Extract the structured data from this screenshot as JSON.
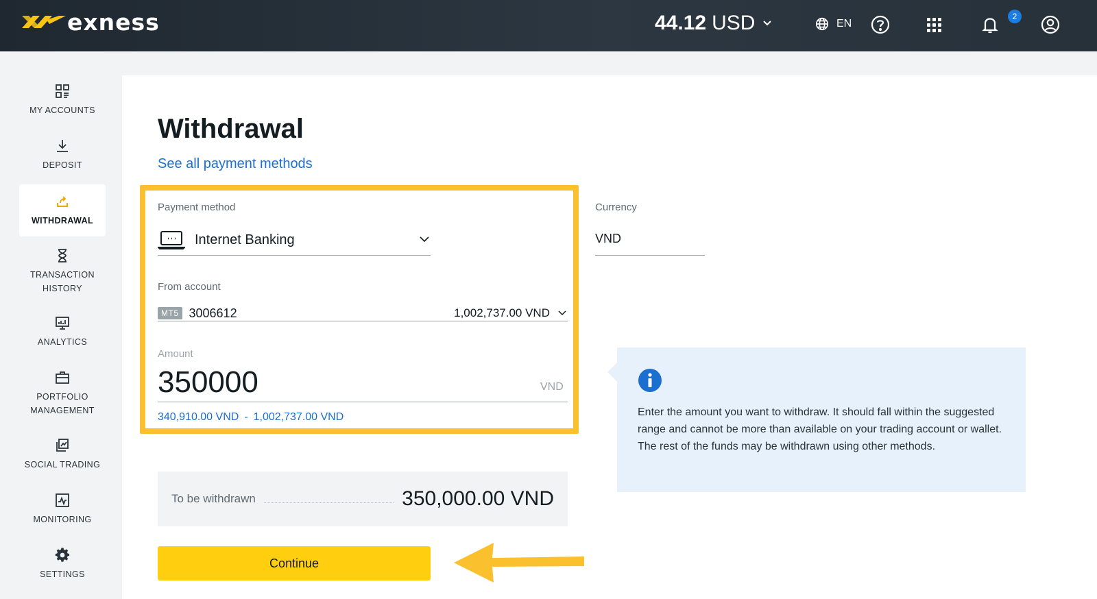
{
  "brand": {
    "name": "exness",
    "logo_icon": "exness-logo-icon"
  },
  "header": {
    "balance_amount": "44.12",
    "balance_currency": "USD",
    "language": "EN",
    "notifications_count": "2",
    "icons": [
      "globe-icon",
      "help-icon",
      "apps-grid-icon",
      "bell-icon",
      "user-icon"
    ]
  },
  "sidebar": {
    "items": [
      {
        "label": "MY ACCOUNTS",
        "icon": "accounts-icon"
      },
      {
        "label": "DEPOSIT",
        "icon": "download-icon"
      },
      {
        "label": "WITHDRAWAL",
        "icon": "withdrawal-icon",
        "active": true
      },
      {
        "label": "TRANSACTION HISTORY",
        "icon": "hourglass-icon"
      },
      {
        "label": "ANALYTICS",
        "icon": "analytics-icon"
      },
      {
        "label": "PORTFOLIO MANAGEMENT",
        "icon": "briefcase-icon"
      },
      {
        "label": "SOCIAL TRADING",
        "icon": "social-trading-icon"
      },
      {
        "label": "MONITORING",
        "icon": "monitoring-icon"
      },
      {
        "label": "SETTINGS",
        "icon": "gear-icon"
      }
    ]
  },
  "main": {
    "title": "Withdrawal",
    "payment_methods_link": "See all payment methods",
    "payment_method": {
      "label": "Payment method",
      "value": "Internet Banking"
    },
    "currency": {
      "label": "Currency",
      "value": "VND"
    },
    "from_account": {
      "label": "From account",
      "platform": "MT5",
      "number": "3006612",
      "balance": "1,002,737.00 VND"
    },
    "amount": {
      "label": "Amount",
      "value": "350000",
      "unit": "VND"
    },
    "range": {
      "min": "340,910.00 VND",
      "separator": "-",
      "max": "1,002,737.00 VND"
    },
    "summary": {
      "label": "To be withdrawn",
      "value": "350,000.00 VND"
    },
    "continue_label": "Continue"
  },
  "info": {
    "text": "Enter the amount you want to withdraw. It should fall within the suggested range and cannot be more than available on your trading account or wallet. The rest of the funds may be withdrawn using other methods."
  },
  "colors": {
    "accent": "#ffcf0f",
    "highlight": "#fbc02d",
    "link": "#1a6fcf",
    "info_bg": "#e6f1fb",
    "header_bg": "#27313a"
  }
}
